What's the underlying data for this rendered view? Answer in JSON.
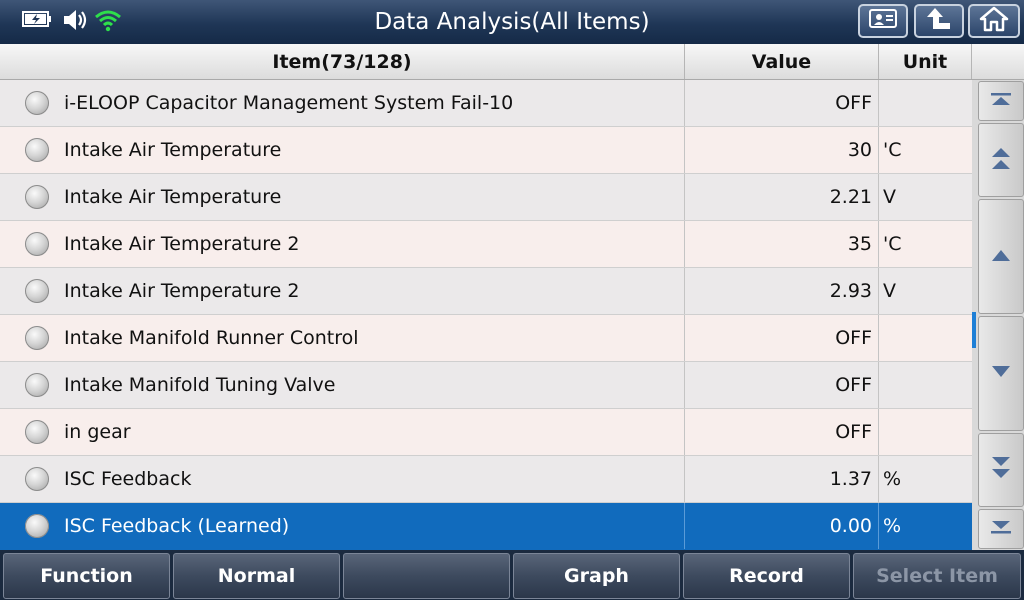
{
  "titlebar": {
    "title": "Data Analysis(All Items)",
    "status_icons": [
      "battery-charging-icon",
      "speaker-icon",
      "wifi-icon"
    ],
    "buttons": [
      "report-icon",
      "back-icon",
      "home-icon"
    ]
  },
  "table": {
    "headers": {
      "item": "Item(73/128)",
      "value": "Value",
      "unit": "Unit"
    },
    "rows": [
      {
        "item": "i-ELOOP Capacitor Management System Fail-10",
        "value": "OFF",
        "unit": ""
      },
      {
        "item": "Intake Air Temperature",
        "value": "30",
        "unit": "'C"
      },
      {
        "item": "Intake Air Temperature",
        "value": "2.21",
        "unit": "V"
      },
      {
        "item": "Intake Air Temperature 2",
        "value": "35",
        "unit": "'C"
      },
      {
        "item": "Intake Air Temperature 2",
        "value": "2.93",
        "unit": "V"
      },
      {
        "item": "Intake Manifold Runner Control",
        "value": "OFF",
        "unit": ""
      },
      {
        "item": "Intake Manifold Tuning Valve",
        "value": "OFF",
        "unit": ""
      },
      {
        "item": "in gear",
        "value": "OFF",
        "unit": ""
      },
      {
        "item": "ISC Feedback",
        "value": "1.37",
        "unit": "%"
      },
      {
        "item": "ISC Feedback (Learned)",
        "value": "0.00",
        "unit": "%",
        "selected": true
      }
    ]
  },
  "scrollbar": {
    "buttons": [
      "scroll-top-icon",
      "page-up-icon",
      "scroll-up-icon",
      "scroll-down-icon",
      "page-down-icon",
      "scroll-bottom-icon"
    ]
  },
  "toolbar": {
    "function": "Function",
    "normal": "Normal",
    "blank": "",
    "graph": "Graph",
    "record": "Record",
    "select_item": "Select Item"
  },
  "colors": {
    "titlebar": "#1f3656",
    "selected_row": "#116bbd",
    "toolbar": "#3d4a5e"
  }
}
